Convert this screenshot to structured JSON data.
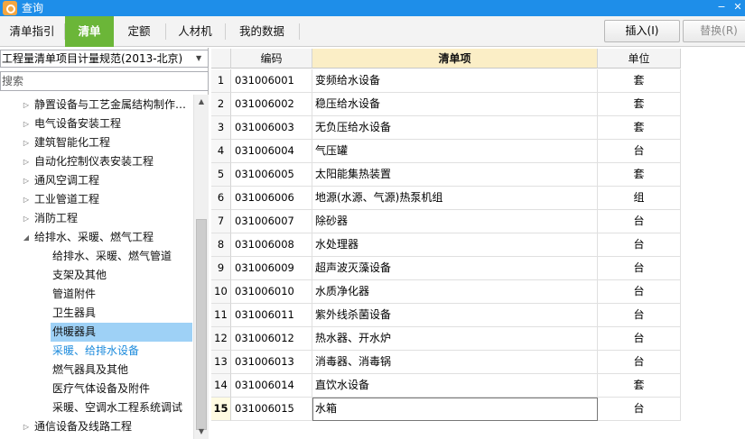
{
  "window": {
    "title": "查询",
    "minimize": "−",
    "close": "✕"
  },
  "tabs": [
    {
      "label": "清单指引",
      "active": false
    },
    {
      "label": "清单",
      "active": true
    },
    {
      "label": "定额",
      "active": false
    },
    {
      "label": "人材机",
      "active": false
    },
    {
      "label": "我的数据",
      "active": false
    }
  ],
  "toolbar": {
    "insert_label": "插入(I)",
    "replace_label": "替换(R)"
  },
  "left": {
    "standard_selected": "工程量清单项目计量规范(2013-北京)",
    "search_placeholder": "搜索"
  },
  "tree": [
    {
      "label": "静置设备与工艺金属结构制作…",
      "level": 1,
      "expander": "collapsed"
    },
    {
      "label": "电气设备安装工程",
      "level": 1,
      "expander": "collapsed"
    },
    {
      "label": "建筑智能化工程",
      "level": 1,
      "expander": "collapsed"
    },
    {
      "label": "自动化控制仪表安装工程",
      "level": 1,
      "expander": "collapsed"
    },
    {
      "label": "通风空调工程",
      "level": 1,
      "expander": "collapsed"
    },
    {
      "label": "工业管道工程",
      "level": 1,
      "expander": "collapsed"
    },
    {
      "label": "消防工程",
      "level": 1,
      "expander": "collapsed"
    },
    {
      "label": "给排水、采暖、燃气工程",
      "level": 1,
      "expander": "expanded"
    },
    {
      "label": "给排水、采暖、燃气管道",
      "level": 2
    },
    {
      "label": "支架及其他",
      "level": 2
    },
    {
      "label": "管道附件",
      "level": 2
    },
    {
      "label": "卫生器具",
      "level": 2
    },
    {
      "label": "供暖器具",
      "level": 2,
      "selected": true
    },
    {
      "label": "采暖、给排水设备",
      "level": 2,
      "highlighted": true
    },
    {
      "label": "燃气器具及其他",
      "level": 2
    },
    {
      "label": "医疗气体设备及附件",
      "level": 2
    },
    {
      "label": "采暖、空调水工程系统调试",
      "level": 2
    },
    {
      "label": "通信设备及线路工程",
      "level": 1,
      "expander": "collapsed"
    }
  ],
  "grid": {
    "headers": {
      "code": "编码",
      "name": "清单项",
      "unit": "单位"
    },
    "rows": [
      {
        "num": "1",
        "code": "031006001",
        "name": "变频给水设备",
        "unit": "套"
      },
      {
        "num": "2",
        "code": "031006002",
        "name": "稳压给水设备",
        "unit": "套"
      },
      {
        "num": "3",
        "code": "031006003",
        "name": "无负压给水设备",
        "unit": "套"
      },
      {
        "num": "4",
        "code": "031006004",
        "name": "气压罐",
        "unit": "台"
      },
      {
        "num": "5",
        "code": "031006005",
        "name": "太阳能集热装置",
        "unit": "套"
      },
      {
        "num": "6",
        "code": "031006006",
        "name": "地源(水源、气源)热泵机组",
        "unit": "组"
      },
      {
        "num": "7",
        "code": "031006007",
        "name": "除砂器",
        "unit": "台"
      },
      {
        "num": "8",
        "code": "031006008",
        "name": "水处理器",
        "unit": "台"
      },
      {
        "num": "9",
        "code": "031006009",
        "name": "超声波灭藻设备",
        "unit": "台"
      },
      {
        "num": "10",
        "code": "031006010",
        "name": "水质净化器",
        "unit": "台"
      },
      {
        "num": "11",
        "code": "031006011",
        "name": "紫外线杀菌设备",
        "unit": "台"
      },
      {
        "num": "12",
        "code": "031006012",
        "name": "热水器、开水炉",
        "unit": "台"
      },
      {
        "num": "13",
        "code": "031006013",
        "name": "消毒器、消毒锅",
        "unit": "台"
      },
      {
        "num": "14",
        "code": "031006014",
        "name": "直饮水设备",
        "unit": "套"
      },
      {
        "num": "15",
        "code": "031006015",
        "name": "水箱",
        "unit": "台",
        "current": true
      }
    ]
  },
  "colors": {
    "title_bar": "#1e8ee9",
    "active_tab": "#6bb638",
    "tree_selected": "#9ed1f6",
    "tree_highlight_text": "#1d8bdc",
    "key_header": "#fbeec6"
  },
  "icons": [
    "app-logo-icon",
    "minimize-icon",
    "close-icon",
    "dropdown-arrow-icon",
    "expand-triangle-icon",
    "collapse-triangle-icon",
    "scroll-up-icon",
    "scroll-down-icon"
  ]
}
